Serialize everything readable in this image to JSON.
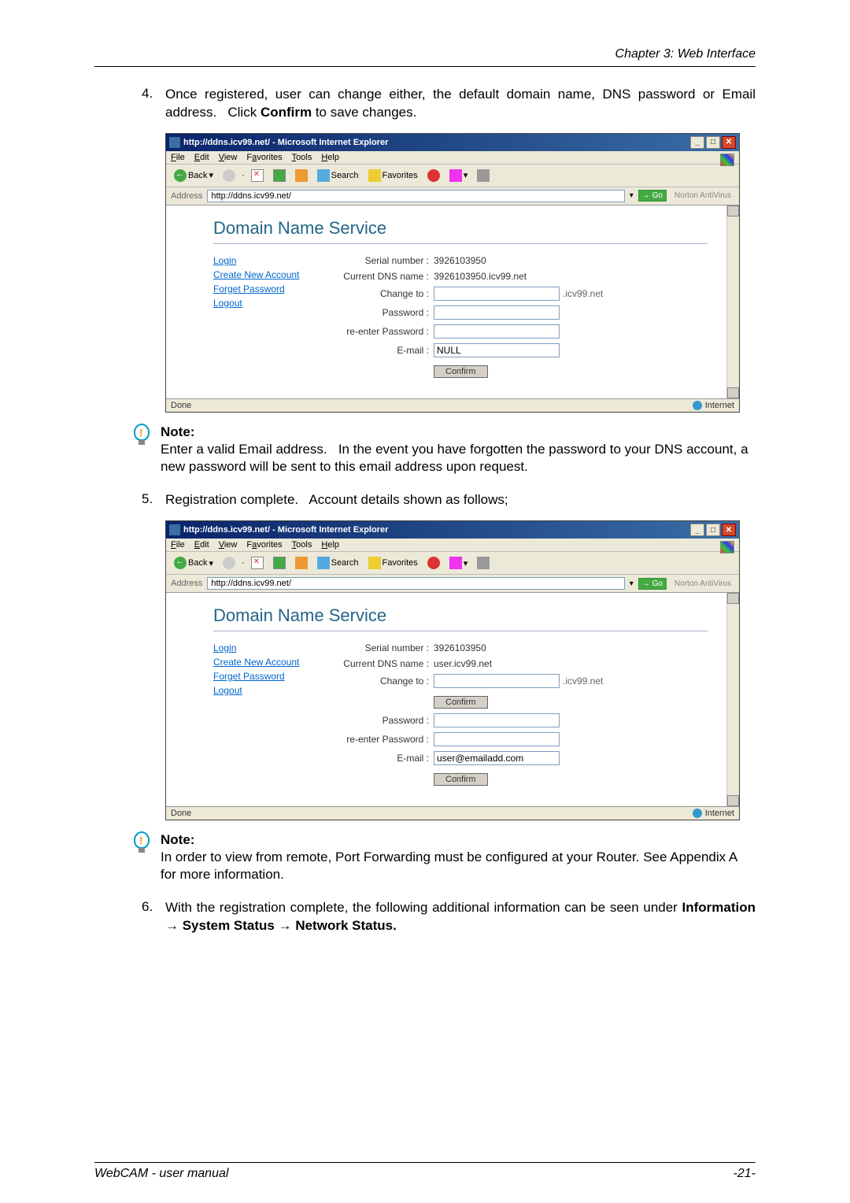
{
  "header": {
    "chapter": "Chapter 3: Web Interface"
  },
  "step4": {
    "num": "4.",
    "text_a": "Once registered, user can change either, the default domain name, DNS password or Email address.   Click ",
    "bold": "Confirm",
    "text_b": " to save changes."
  },
  "ie_window": {
    "title": "http://ddns.icv99.net/ - Microsoft Internet Explorer",
    "menu": {
      "file": "File",
      "edit": "Edit",
      "view": "View",
      "fav": "Favorites",
      "tools": "Tools",
      "help": "Help"
    },
    "tb": {
      "back": "Back",
      "search": "Search",
      "favorites": "Favorites"
    },
    "addr_label": "Address",
    "url": "http://ddns.icv99.net/",
    "go": "Go",
    "norton": "Norton AntiVirus",
    "status_done": "Done",
    "status_zone": "Internet"
  },
  "dns1": {
    "title": "Domain Name Service",
    "nav": {
      "login": "Login",
      "create": "Create New Account",
      "forgot": "Forget Password",
      "logout": "Logout"
    },
    "serial_lbl": "Serial number :",
    "serial_val": "3926103950",
    "curdns_lbl": "Current DNS name :",
    "curdns_val": "3926103950.icv99.net",
    "change_lbl": "Change to :",
    "suffix": ".icv99.net",
    "pw_lbl": "Password :",
    "repw_lbl": "re-enter Password :",
    "email_lbl": "E-mail :",
    "email_val": "NULL",
    "confirm": "Confirm"
  },
  "note1": {
    "heading": "Note:",
    "body": "Enter a valid Email address.   In the event you have forgotten the password to your DNS account, a new password will be sent to this email address upon request."
  },
  "step5": {
    "num": "5.",
    "text": "Registration complete.   Account details shown as follows;"
  },
  "dns2": {
    "title": "Domain Name Service",
    "nav": {
      "login": "Login",
      "create": "Create New Account",
      "forgot": "Forget Password",
      "logout": "Logout"
    },
    "serial_lbl": "Serial number :",
    "serial_val": "3926103950",
    "curdns_lbl": "Current DNS name :",
    "curdns_val": "user.icv99.net",
    "change_lbl": "Change to :",
    "suffix": ".icv99.net",
    "pw_lbl": "Password :",
    "repw_lbl": "re-enter Password :",
    "email_lbl": "E-mail :",
    "email_val": "user@emailadd.com",
    "confirm": "Confirm"
  },
  "note2": {
    "heading": "Note:",
    "body": "In order to view from remote, Port Forwarding must be configured at your Router. See Appendix A for more information."
  },
  "step6": {
    "num": "6.",
    "text_a": "With the registration complete, the following additional information can be seen under ",
    "bold": "Information → System Status → Network Status."
  },
  "footer": {
    "left": "WebCAM - user manual",
    "right": "-21-"
  }
}
